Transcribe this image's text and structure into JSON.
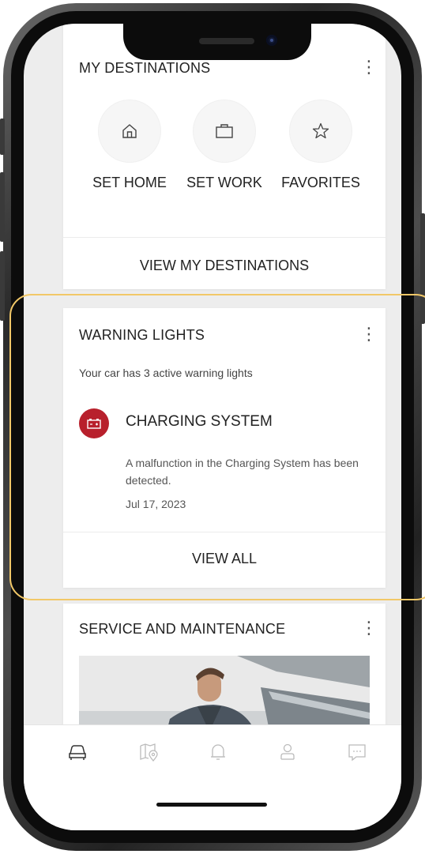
{
  "destinations": {
    "title": "MY DESTINATIONS",
    "buttons": [
      {
        "label": "SET HOME",
        "icon": "home-icon"
      },
      {
        "label": "SET WORK",
        "icon": "briefcase-icon"
      },
      {
        "label": "FAVORITES",
        "icon": "star-icon"
      }
    ],
    "view_link": "VIEW MY DESTINATIONS"
  },
  "warning_lights": {
    "title": "WARNING LIGHTS",
    "summary": "Your car has 3 active warning lights",
    "item": {
      "icon": "battery-icon",
      "title": "CHARGING SYSTEM",
      "description": "A malfunction in the Charging System has been detected.",
      "date": "Jul 17, 2023"
    },
    "view_all": "VIEW ALL"
  },
  "service": {
    "title": "SERVICE AND MAINTENANCE"
  },
  "menu_glyph": "⋮",
  "tab_bar": {
    "tabs": [
      "car-icon",
      "map-pin-icon",
      "bell-icon",
      "profile-icon",
      "chat-icon"
    ],
    "active": "car-icon"
  },
  "colors": {
    "warning_red": "#b8202c",
    "highlight": "#f2c868",
    "screen_bg": "#ededed"
  }
}
